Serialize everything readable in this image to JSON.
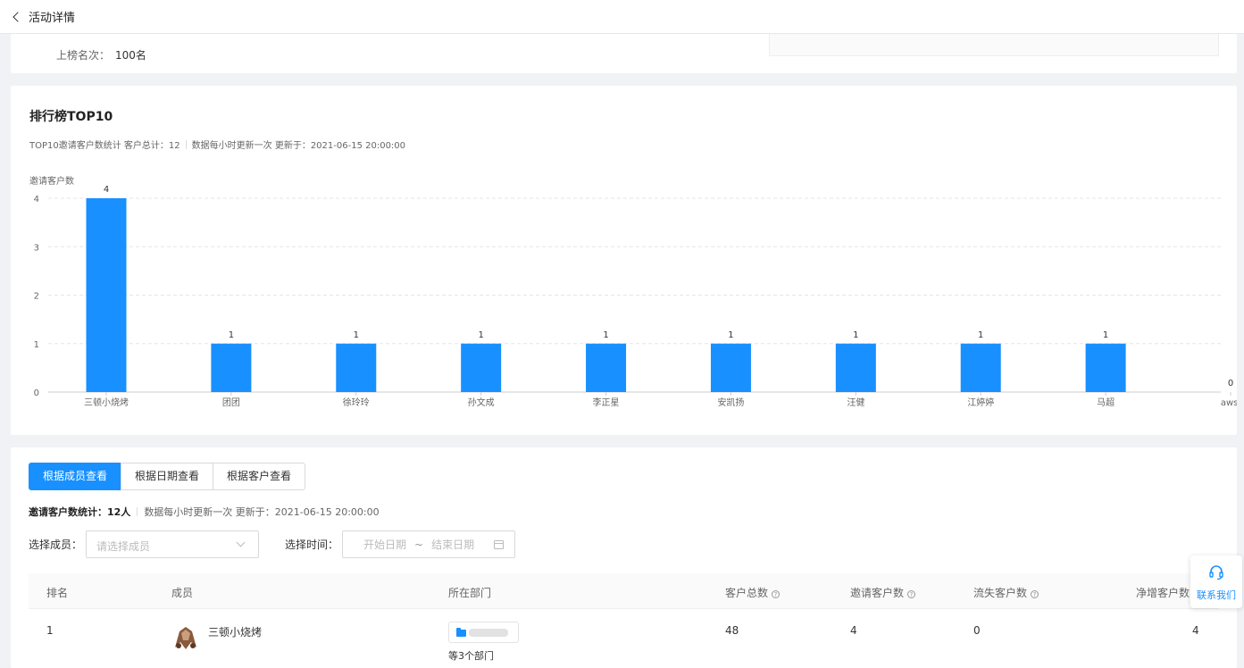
{
  "header": {
    "title": "活动详情"
  },
  "top_card": {
    "rank_label": "上榜名次：",
    "rank_value": "100名"
  },
  "leaderboard": {
    "title": "排行榜TOP10",
    "subtitle_a": "TOP10邀请客户数统计 客户总计：12",
    "subtitle_b": "数据每小时更新一次  更新于：2021-06-15 20:00:00"
  },
  "chart_data": {
    "type": "bar",
    "ylabel": "邀请客户数",
    "ylim": [
      0,
      4
    ],
    "yticks": [
      0,
      1,
      2,
      3,
      4
    ],
    "categories": [
      "三顿小烧烤",
      "团团",
      "徐玲玲",
      "孙文成",
      "李正星",
      "安凯扬",
      "汪健",
      "江婷婷",
      "马超",
      "awsl"
    ],
    "values": [
      4,
      1,
      1,
      1,
      1,
      1,
      1,
      1,
      1,
      0
    ],
    "grid": true,
    "bar_color": "#1890ff"
  },
  "tabs": [
    {
      "label": "根据成员查看",
      "active": true
    },
    {
      "label": "根据日期查看",
      "active": false
    },
    {
      "label": "根据客户查看",
      "active": false
    }
  ],
  "stats": {
    "label": "邀请客户数统计：12人",
    "update": "数据每小时更新一次  更新于：2021-06-15 20:00:00"
  },
  "filters": {
    "member_label": "选择成员：",
    "member_placeholder": "请选择成员",
    "time_label": "选择时间：",
    "start_placeholder": "开始日期",
    "tilde": "~",
    "end_placeholder": "结束日期"
  },
  "table": {
    "columns": [
      "排名",
      "成员",
      "所在部门",
      "客户总数",
      "邀请客户数",
      "流失客户数",
      "净增客户数"
    ],
    "rows": [
      {
        "rank": "1",
        "member": "三顿小烧烤",
        "dept_more": "等3个部门",
        "total": "48",
        "invited": "4",
        "lost": "0",
        "net": "4"
      }
    ]
  },
  "help_icon": "?",
  "contact": {
    "label": "联系我们",
    "icon": "headset-icon"
  },
  "accent_color": "#1890ff"
}
